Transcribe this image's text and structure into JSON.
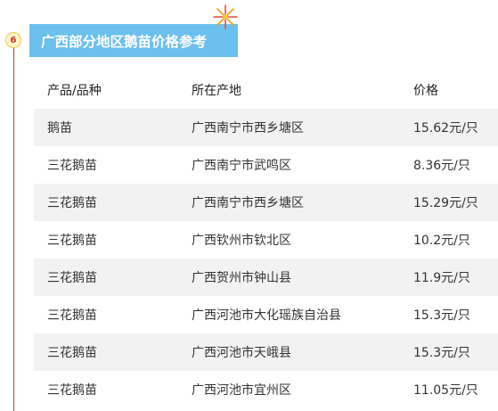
{
  "section": {
    "step_number": "6",
    "title": "广西部分地区鹅苗价格参考"
  },
  "table": {
    "headers": [
      "产品/品种",
      "所在产地",
      "价格"
    ],
    "rows": [
      [
        "鹅苗",
        "广西南宁市西乡塘区",
        "15.62元/只"
      ],
      [
        "三花鹅苗",
        "广西南宁市武鸣区",
        "8.36元/只"
      ],
      [
        "三花鹅苗",
        "广西南宁市西乡塘区",
        "15.29元/只"
      ],
      [
        "三花鹅苗",
        "广西钦州市钦北区",
        "10.2元/只"
      ],
      [
        "三花鹅苗",
        "广西贺州市钟山县",
        "11.9元/只"
      ],
      [
        "三花鹅苗",
        "广西河池市大化瑶族自治县",
        "15.3元/只"
      ],
      [
        "三花鹅苗",
        "广西河池市天峨县",
        "15.3元/只"
      ],
      [
        "三花鹅苗",
        "广西河池市宜州区",
        "11.05元/只"
      ]
    ]
  },
  "colors": {
    "title_background": "#6cc0ee",
    "timeline": "#c0392b",
    "stripe": "#f2f2f2"
  },
  "icons": [
    "firework-icon"
  ]
}
